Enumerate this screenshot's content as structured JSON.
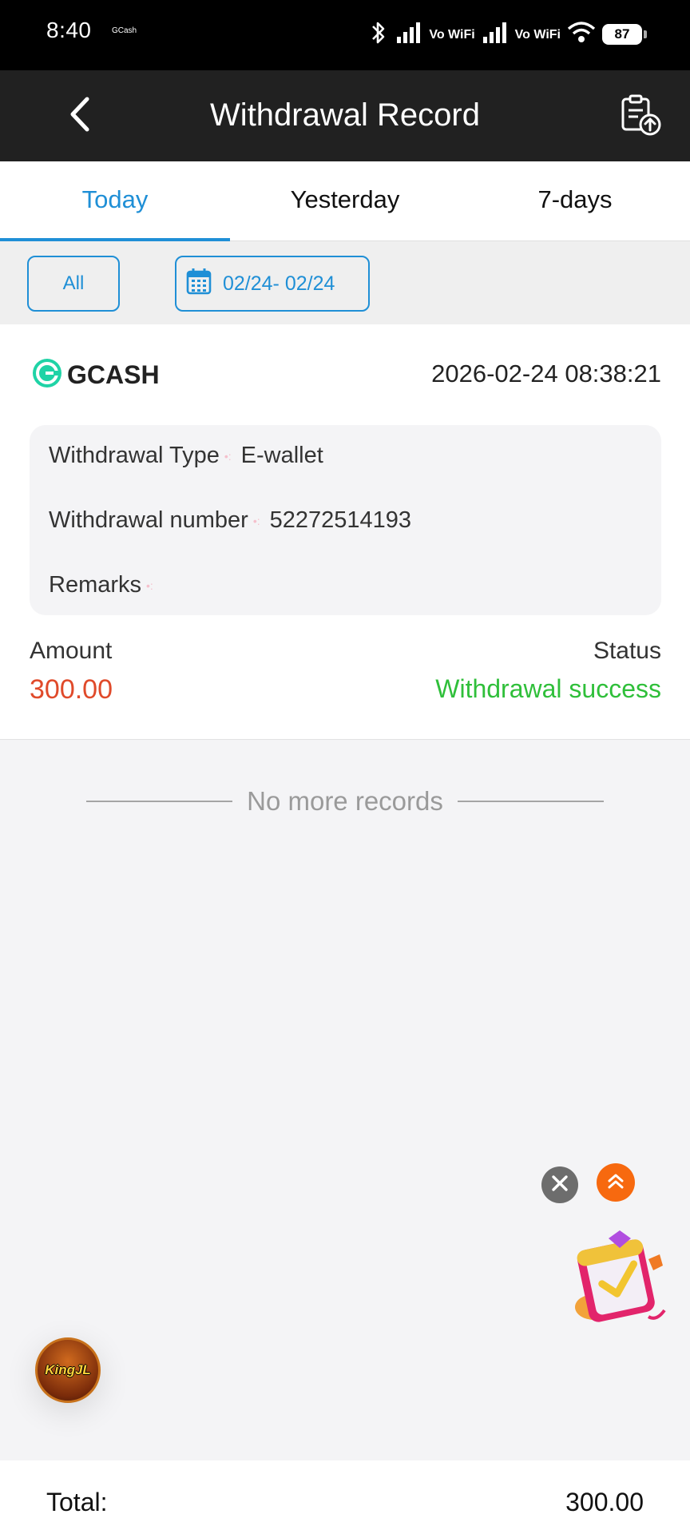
{
  "status_bar": {
    "time": "8:40",
    "app": "GCash",
    "vowifi_1": "Vo WiFi",
    "vowifi_2": "Vo WiFi",
    "battery": "87"
  },
  "header": {
    "title": "Withdrawal Record",
    "back_icon": "chevron-left-icon",
    "upload_icon": "clipboard-upload-icon"
  },
  "tabs": [
    {
      "label": "Today",
      "active": true
    },
    {
      "label": "Yesterday",
      "active": false
    },
    {
      "label": "7-days",
      "active": false
    }
  ],
  "filters": {
    "all_label": "All",
    "date_range": "02/24- 02/24",
    "date_icon": "calendar-icon"
  },
  "record": {
    "provider": "GCASH",
    "datetime": "2026-02-24 08:38:21",
    "type_label": "Withdrawal Type",
    "type_value": "E-wallet",
    "number_label": "Withdrawal number",
    "number_value": "52272514193",
    "remarks_label": "Remarks",
    "remarks_value": "",
    "amount_label": "Amount",
    "amount_value": "300.00",
    "status_label": "Status",
    "status_value": "Withdrawal success"
  },
  "list_end": "No more records",
  "floating": {
    "close_icon": "close-icon",
    "top_icon": "double-chevron-up-icon",
    "gift_icon": "gift-checklist-icon",
    "logo_text": "KingJL"
  },
  "total": {
    "label": "Total:",
    "value": "300.00"
  },
  "colors": {
    "accent": "#1f8fd6",
    "amount": "#e04a2a",
    "success": "#2fbf3a",
    "header_bg": "#212121"
  }
}
